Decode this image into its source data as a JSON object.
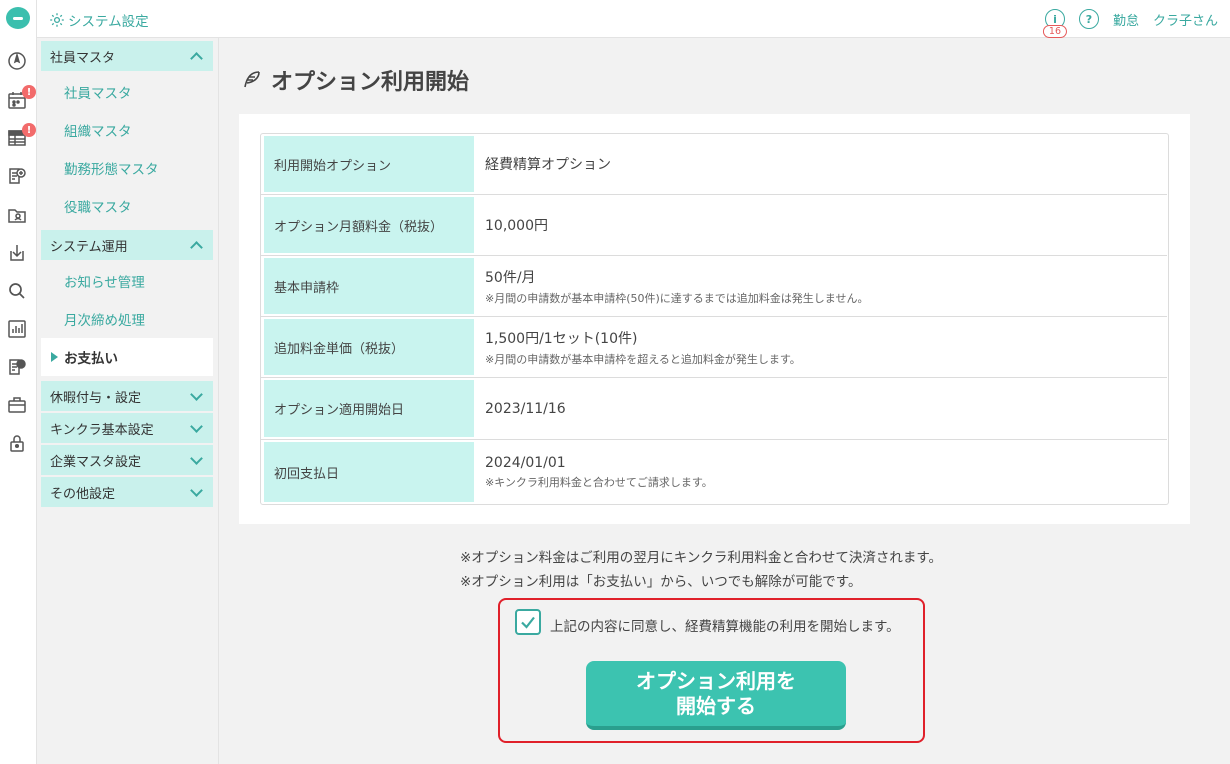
{
  "header": {
    "title": "システム設定",
    "notification_count": "16",
    "user_links": [
      "勤怠",
      "クラ子さん"
    ]
  },
  "sidebar": {
    "sections": [
      {
        "label": "社員マスタ",
        "expanded": true
      },
      {
        "label": "システム運用",
        "expanded": true
      },
      {
        "label": "休暇付与・設定",
        "expanded": false
      },
      {
        "label": "キンクラ基本設定",
        "expanded": false
      },
      {
        "label": "企業マスタ設定",
        "expanded": false
      },
      {
        "label": "その他設定",
        "expanded": false
      }
    ],
    "items": [
      {
        "label": "社員マスタ"
      },
      {
        "label": "組織マスタ"
      },
      {
        "label": "勤務形態マスタ"
      },
      {
        "label": "役職マスタ"
      },
      {
        "label": "お知らせ管理"
      },
      {
        "label": "月次締め処理"
      },
      {
        "label": "お支払い",
        "active": true
      }
    ]
  },
  "page": {
    "title": "オプション利用開始"
  },
  "option_table": [
    {
      "label": "利用開始オプション",
      "value": "経費精算オプション",
      "note": ""
    },
    {
      "label": "オプション月額料金（税抜）",
      "value": "10,000円",
      "note": ""
    },
    {
      "label": "基本申請枠",
      "value": "50件/月",
      "note": "※月間の申請数が基本申請枠(50件)に達するまでは追加料金は発生しません。"
    },
    {
      "label": "追加料金単価（税抜）",
      "value": "1,500円/1セット(10件)",
      "note": "※月間の申請数が基本申請枠を超えると追加料金が発生します。"
    },
    {
      "label": "オプション適用開始日",
      "value": "2023/11/16",
      "note": ""
    },
    {
      "label": "初回支払日",
      "value": "2024/01/01",
      "note": "※キンクラ利用料金と合わせてご請求します。"
    }
  ],
  "notes": [
    "※オプション料金はご利用の翌月にキンクラ利用料金と合わせて決済されます。",
    "※オプション利用は「お支払い」から、いつでも解除が可能です。"
  ],
  "agreement": {
    "checked": true,
    "text": "上記の内容に同意し、経費精算機能の利用を開始します。"
  },
  "start_button": {
    "label": "オプション利用を\n開始する"
  },
  "colors": {
    "accent": "#3aa9a0",
    "label_bg": "#c9f4ef",
    "button": "#3cc3b0",
    "alert": "#f26b6b",
    "highlight_border": "#e0202a"
  }
}
